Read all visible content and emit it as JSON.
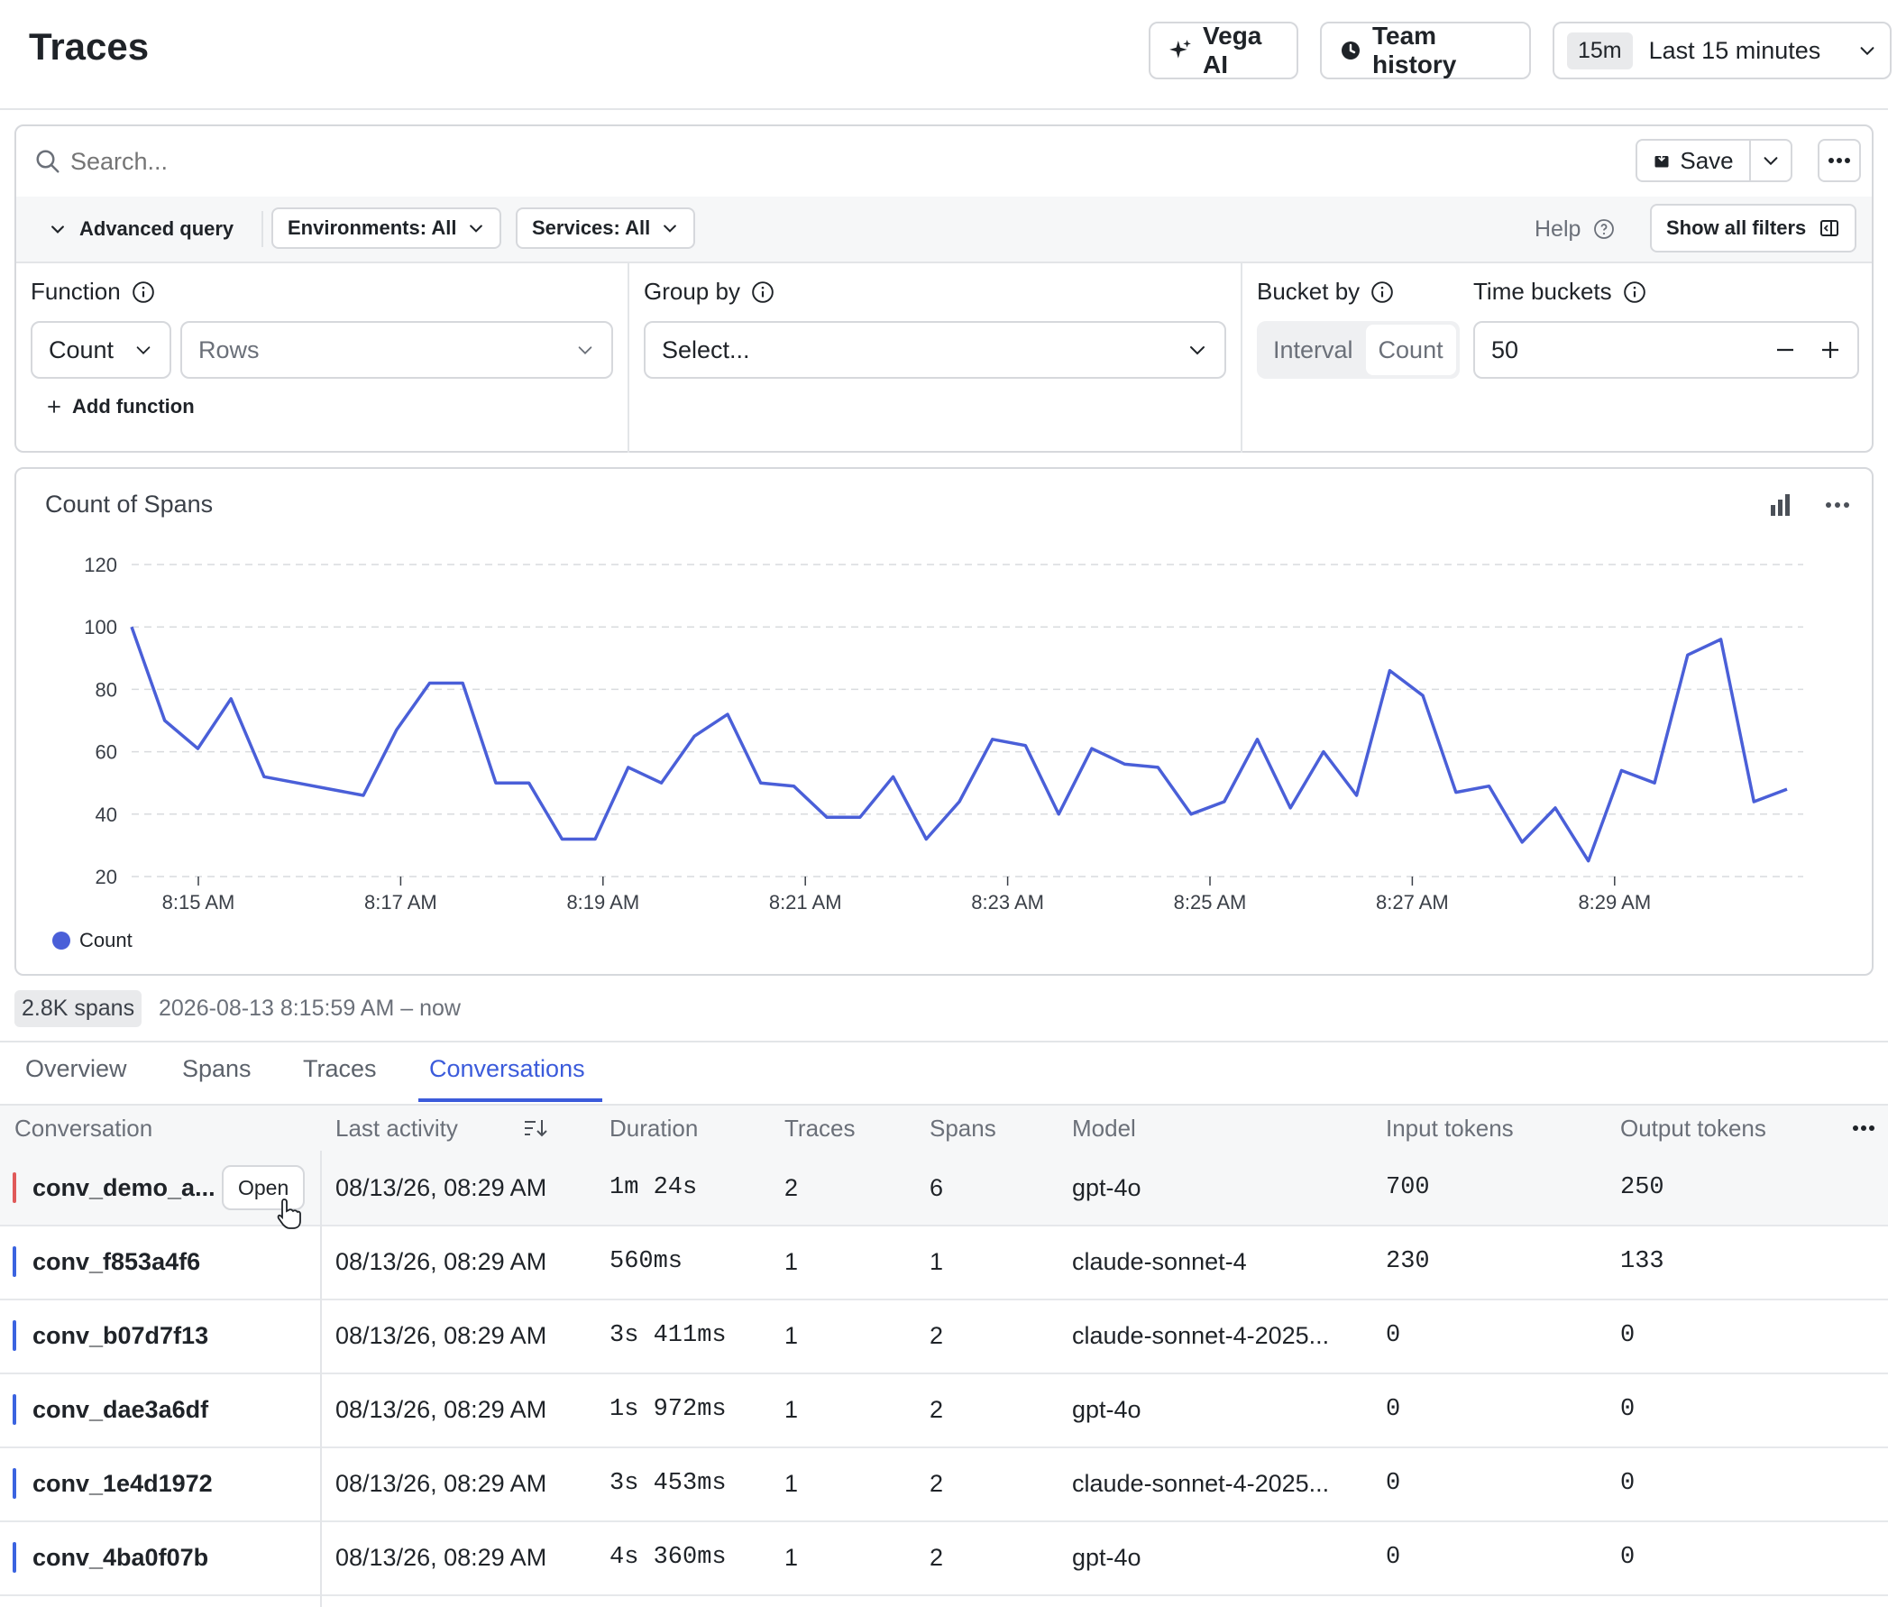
{
  "header": {
    "title": "Traces",
    "vega_label": "Vega AI",
    "team_history_label": "Team history",
    "time_badge": "15m",
    "time_range_label": "Last 15 minutes"
  },
  "query": {
    "search_placeholder": "Search...",
    "save_label": "Save",
    "advanced_query_label": "Advanced query",
    "environments_filter": "Environments: All",
    "services_filter": "Services: All",
    "help_label": "Help",
    "show_all_filters_label": "Show all filters",
    "function": {
      "label": "Function",
      "count_value": "Count",
      "rows_placeholder": "Rows",
      "add_function_label": "Add function"
    },
    "group_by": {
      "label": "Group by",
      "placeholder": "Select..."
    },
    "bucket_by": {
      "label": "Bucket by",
      "options": [
        "Interval",
        "Count"
      ],
      "selected": "Count"
    },
    "time_buckets": {
      "label": "Time buckets",
      "value": "50"
    }
  },
  "chart": {
    "title": "Count of Spans",
    "legend_label": "Count",
    "line_color": "#4a5fd8"
  },
  "chart_data": {
    "type": "line",
    "title": "Count of Spans",
    "xlabel": "",
    "ylabel": "",
    "ylim": [
      20,
      120
    ],
    "yticks": [
      20,
      40,
      60,
      80,
      100,
      120
    ],
    "xticks": [
      "8:15 AM",
      "8:17 AM",
      "8:19 AM",
      "8:21 AM",
      "8:23 AM",
      "8:25 AM",
      "8:27 AM",
      "8:29 AM"
    ],
    "grid": true,
    "legend": "bottom-left",
    "series": [
      {
        "name": "Count",
        "color": "#4a5fd8",
        "values": [
          100,
          70,
          61,
          77,
          52,
          50,
          48,
          46,
          67,
          82,
          82,
          50,
          50,
          32,
          32,
          55,
          50,
          65,
          72,
          50,
          49,
          39,
          39,
          52,
          32,
          44,
          64,
          62,
          40,
          61,
          56,
          55,
          40,
          44,
          64,
          42,
          60,
          46,
          86,
          78,
          47,
          49,
          31,
          42,
          25,
          54,
          50,
          91,
          96,
          44,
          48
        ]
      }
    ]
  },
  "summary": {
    "span_count": "2.8K spans",
    "range_text": "2026-08-13 8:15:59 AM – now"
  },
  "tabs": [
    {
      "label": "Overview"
    },
    {
      "label": "Spans"
    },
    {
      "label": "Traces"
    },
    {
      "label": "Conversations"
    }
  ],
  "table": {
    "columns": [
      "Conversation",
      "Last activity",
      "Duration",
      "Traces",
      "Spans",
      "Model",
      "Input tokens",
      "Output tokens"
    ],
    "open_label": "Open",
    "rows": [
      {
        "conversation": "conv_demo_a...",
        "last_activity": "08/13/26, 08:29 AM",
        "duration": "1m 24s",
        "traces": "2",
        "spans": "6",
        "model": "gpt-4o",
        "input_tokens": "700",
        "output_tokens": "250",
        "marker_color": "#e05a5a"
      },
      {
        "conversation": "conv_f853a4f6",
        "last_activity": "08/13/26, 08:29 AM",
        "duration": "560ms",
        "traces": "1",
        "spans": "1",
        "model": "claude-sonnet-4",
        "input_tokens": "230",
        "output_tokens": "133",
        "marker_color": "#3b63e0"
      },
      {
        "conversation": "conv_b07d7f13",
        "last_activity": "08/13/26, 08:29 AM",
        "duration": "3s 411ms",
        "traces": "1",
        "spans": "2",
        "model": "claude-sonnet-4-2025...",
        "input_tokens": "0",
        "output_tokens": "0",
        "marker_color": "#3b63e0"
      },
      {
        "conversation": "conv_dae3a6df",
        "last_activity": "08/13/26, 08:29 AM",
        "duration": "1s 972ms",
        "traces": "1",
        "spans": "2",
        "model": "gpt-4o",
        "input_tokens": "0",
        "output_tokens": "0",
        "marker_color": "#3b63e0"
      },
      {
        "conversation": "conv_1e4d1972",
        "last_activity": "08/13/26, 08:29 AM",
        "duration": "3s 453ms",
        "traces": "1",
        "spans": "2",
        "model": "claude-sonnet-4-2025...",
        "input_tokens": "0",
        "output_tokens": "0",
        "marker_color": "#3b63e0"
      },
      {
        "conversation": "conv_4ba0f07b",
        "last_activity": "08/13/26, 08:29 AM",
        "duration": "4s 360ms",
        "traces": "1",
        "spans": "2",
        "model": "gpt-4o",
        "input_tokens": "0",
        "output_tokens": "0",
        "marker_color": "#3b63e0"
      }
    ]
  }
}
